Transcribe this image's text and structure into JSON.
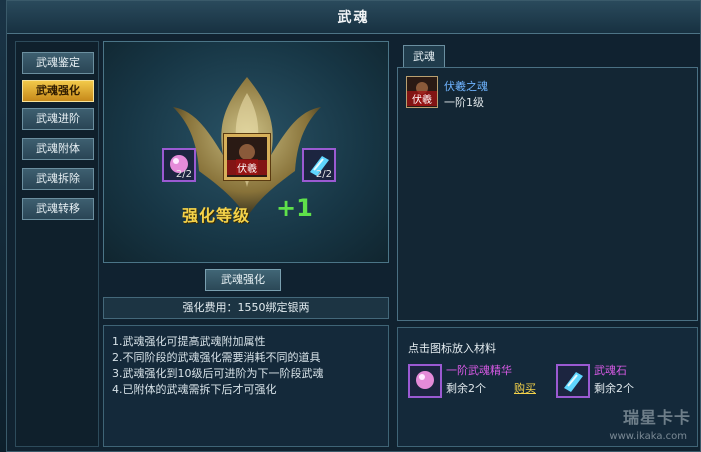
{
  "window": {
    "title": "武魂",
    "top_right_lines": [
      "",
      ""
    ]
  },
  "sidebar": {
    "items": [
      {
        "label": "武魂鉴定",
        "active": false
      },
      {
        "label": "武魂强化",
        "active": true
      },
      {
        "label": "武魂进阶",
        "active": false
      },
      {
        "label": "武魂附体",
        "active": false
      },
      {
        "label": "武魂拆除",
        "active": false
      },
      {
        "label": "武魂转移",
        "active": false
      }
    ]
  },
  "main": {
    "left_slot_count": "2/2",
    "center_slot_tag": "伏羲",
    "right_slot_count": "2/2",
    "level_label": "强化等级",
    "level_value": "+1",
    "action_button": "武魂强化",
    "cost_text": "强化费用：1550绑定银两",
    "descriptions": [
      "1.武魂强化可提高武魂附加属性",
      "2.不同阶段的武魂强化需要消耗不同的道具",
      "3.武魂强化到10级后可进阶为下一阶段武魂",
      "4.已附体的武魂需拆下后才可强化"
    ]
  },
  "right": {
    "tab_label": "武魂",
    "items": [
      {
        "name": "伏羲之魂",
        "level": "一阶1级",
        "icon_tag": "伏羲"
      }
    ],
    "materials_title": "点击图标放入材料",
    "materials": [
      {
        "name": "一阶武魂精华",
        "left": "剩余2个",
        "buy": "购买"
      },
      {
        "name": "武魂石",
        "left": "剩余2个"
      }
    ]
  },
  "watermark": {
    "brand": "瑞星卡卡",
    "url": "www.ikaka.com"
  },
  "colors": {
    "active_tab": "#f2c94a",
    "level_text": "#f4d24a",
    "plus_text": "#5fe14a",
    "material_name": "#d95ae6",
    "item_name": "#6fb4ff"
  }
}
